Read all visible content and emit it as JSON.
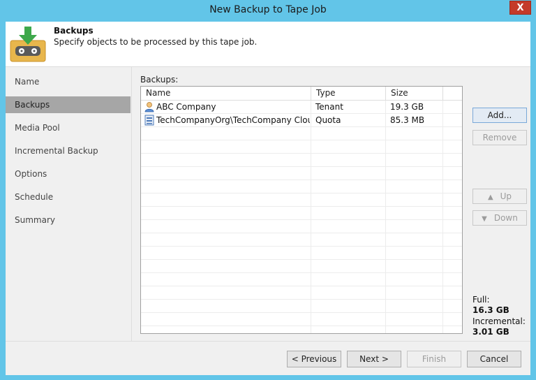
{
  "window": {
    "title": "New Backup to Tape Job",
    "close_glyph": "X"
  },
  "header": {
    "title": "Backups",
    "description": "Specify objects to be processed by this tape job.",
    "icon": "tape-backup-icon"
  },
  "nav": {
    "items": [
      {
        "label": "Name",
        "active": false
      },
      {
        "label": "Backups",
        "active": true
      },
      {
        "label": "Media Pool",
        "active": false
      },
      {
        "label": "Incremental Backup",
        "active": false
      },
      {
        "label": "Options",
        "active": false
      },
      {
        "label": "Schedule",
        "active": false
      },
      {
        "label": "Summary",
        "active": false
      }
    ]
  },
  "main": {
    "section_label": "Backups:",
    "table": {
      "columns": [
        "Name",
        "Type",
        "Size"
      ],
      "rows": [
        {
          "icon": "tenant-user-icon",
          "name": "ABC Company",
          "type": "Tenant",
          "size": "19.3 GB"
        },
        {
          "icon": "quota-storage-icon",
          "name": "TechCompanyOrg\\TechCompany Clou...",
          "type": "Quota",
          "size": "85.3 MB"
        }
      ]
    },
    "buttons": {
      "add": "Add...",
      "remove": "Remove",
      "up": "Up",
      "down": "Down"
    },
    "summary": {
      "full_label": "Full:",
      "full_value": "16.3 GB",
      "incremental_label": "Incremental:",
      "incremental_value": "3.01 GB"
    }
  },
  "footer": {
    "previous": "< Previous",
    "next": "Next >",
    "finish": "Finish",
    "cancel": "Cancel"
  }
}
